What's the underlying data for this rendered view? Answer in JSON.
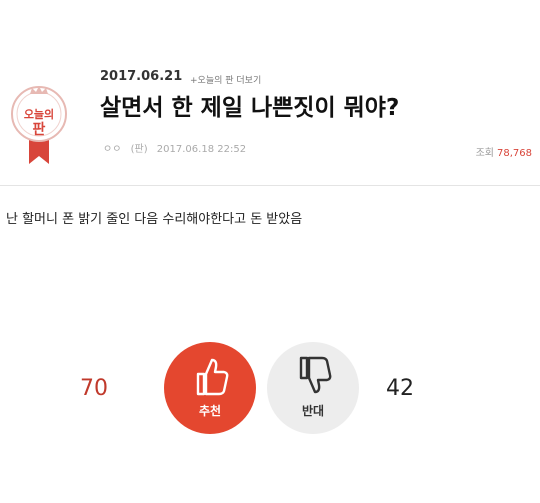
{
  "badge": {
    "line1": "오늘의",
    "line2": "판"
  },
  "post": {
    "date": "2017.06.21",
    "more_link": "+오늘의 판 더보기",
    "title": "살면서 한 제일 나쁜짓이 뭐야?",
    "author": "ㅇㅇ",
    "source": "(판)",
    "timestamp": "2017.06.18 22:52",
    "views_label": "조회",
    "views_count": "78,768",
    "body": "난 할머니 폰 밝기 줄인 다음 수리해야한다고 돈 받았음"
  },
  "votes": {
    "up_count": "70",
    "up_label": "추천",
    "down_count": "42",
    "down_label": "반대"
  },
  "colors": {
    "accent": "#e4472f",
    "badge_red": "#d8453a"
  }
}
